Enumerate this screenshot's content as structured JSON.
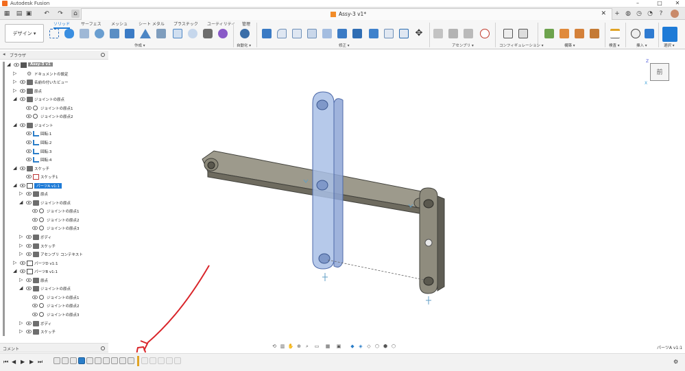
{
  "app": {
    "title": "Autodesk Fusion"
  },
  "document_tab": {
    "title": "Assy-3 v1*"
  },
  "workspace": {
    "label": "デザイン ▾"
  },
  "ribbon": {
    "tabs": [
      "ソリッド",
      "サーフェス",
      "メッシュ",
      "シート メタル",
      "プラスチック",
      "ユーティリティ",
      "管理"
    ],
    "active_tab": "ソリッド",
    "groups": [
      "作成 ▾",
      "自動化 ▾",
      "修正 ▾",
      "アセンブリ ▾",
      "コンフィギュレーション ▾",
      "構築 ▾",
      "検査 ▾",
      "挿入 ▾",
      "選択 ▾"
    ]
  },
  "browser": {
    "title": "ブラウザ",
    "rows": [
      {
        "label": "Assy-3 v1",
        "type": "root"
      },
      {
        "label": "ドキュメントの設定",
        "type": "gear"
      },
      {
        "label": "名前の付いたビュー",
        "type": "folder"
      },
      {
        "label": "原点",
        "type": "folder"
      },
      {
        "label": "ジョイントの原点",
        "type": "folder"
      },
      {
        "label": "ジョイントの原点1",
        "type": "origin"
      },
      {
        "label": "ジョイントの原点2",
        "type": "origin"
      },
      {
        "label": "ジョイント",
        "type": "folder"
      },
      {
        "label": "回転:1",
        "type": "joint"
      },
      {
        "label": "回転:2",
        "type": "joint"
      },
      {
        "label": "回転:3",
        "type": "joint"
      },
      {
        "label": "回転:4",
        "type": "joint"
      },
      {
        "label": "スケッチ",
        "type": "folder"
      },
      {
        "label": "スケッチ1",
        "type": "sketch"
      },
      {
        "label": "パーツA v1:1",
        "type": "component-selected"
      },
      {
        "label": "原点",
        "type": "folder"
      },
      {
        "label": "ジョイントの原点",
        "type": "folder"
      },
      {
        "label": "ジョイントの原点1",
        "type": "origin"
      },
      {
        "label": "ジョイントの原点2",
        "type": "origin"
      },
      {
        "label": "ジョイントの原点3",
        "type": "origin"
      },
      {
        "label": "ボディ",
        "type": "folder"
      },
      {
        "label": "スケッチ",
        "type": "folder"
      },
      {
        "label": "アセンブリ コンテキスト",
        "type": "folder"
      },
      {
        "label": "パーツD v1:1",
        "type": "component"
      },
      {
        "label": "パーツB v1:1",
        "type": "component"
      },
      {
        "label": "原点",
        "type": "folder"
      },
      {
        "label": "ジョイントの原点",
        "type": "folder"
      },
      {
        "label": "ジョイントの原点1",
        "type": "origin"
      },
      {
        "label": "ジョイントの原点2",
        "type": "origin"
      },
      {
        "label": "ジョイントの原点3",
        "type": "origin"
      },
      {
        "label": "ボディ",
        "type": "folder"
      },
      {
        "label": "スケッチ",
        "type": "folder"
      }
    ]
  },
  "comments": {
    "title": "コメント"
  },
  "status": {
    "selection": "パーツA v1:1"
  },
  "viewcube": {
    "face": "前"
  },
  "colors": {
    "accent": "#1e7bd7",
    "selected_body": "#a9bfe6",
    "body": "#8a8778",
    "annotation": "#d9252a"
  }
}
